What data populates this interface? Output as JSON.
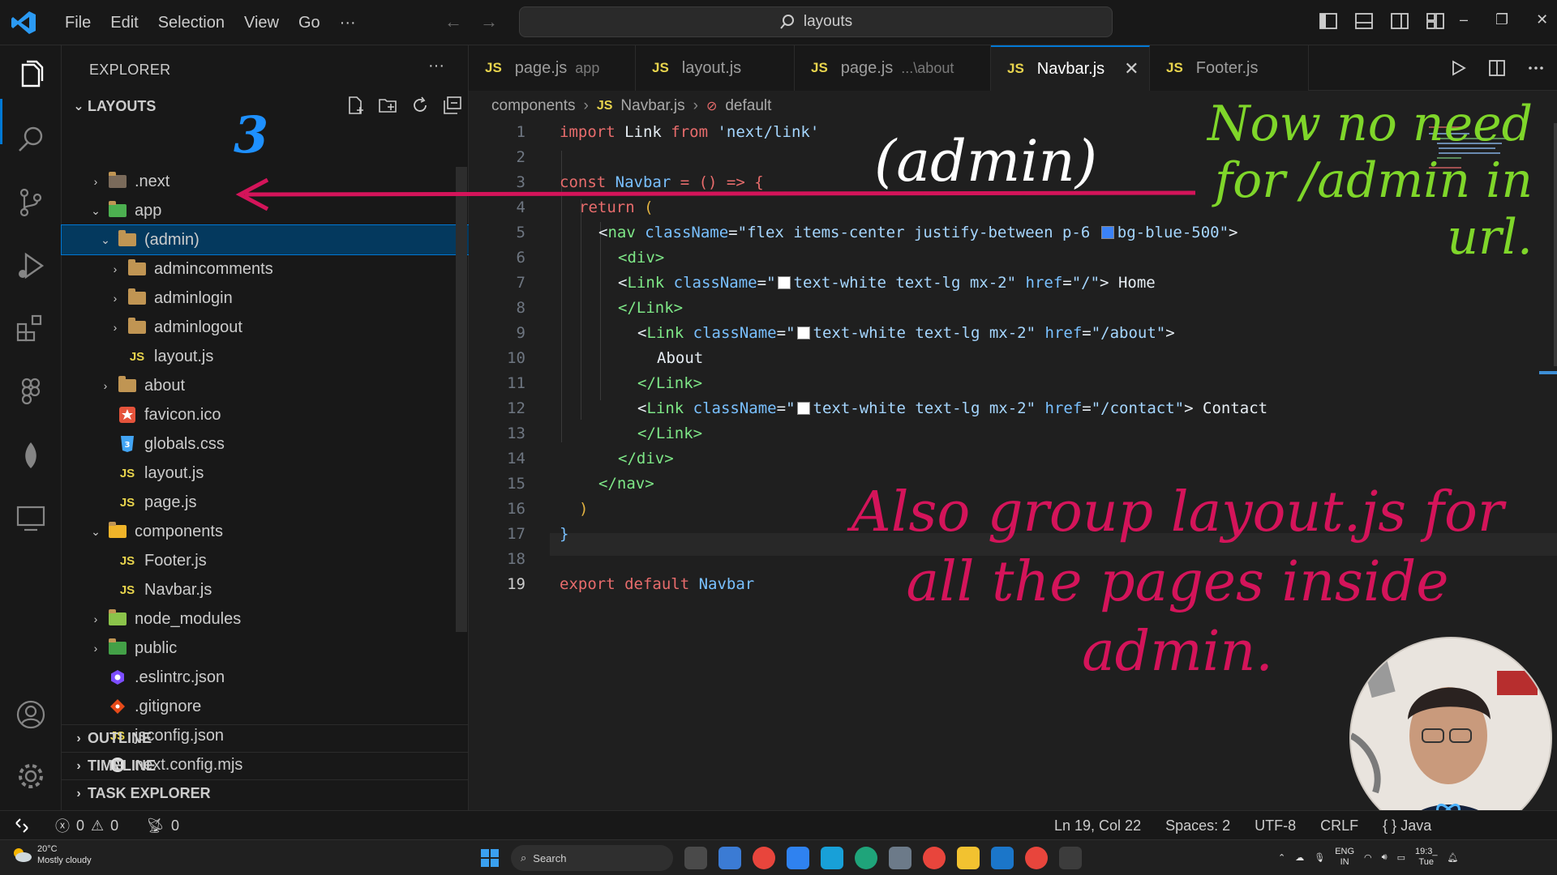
{
  "titlebar": {
    "menu": [
      "File",
      "Edit",
      "Selection",
      "View",
      "Go",
      "···"
    ],
    "search_text": "layouts"
  },
  "explorer": {
    "title": "EXPLORER",
    "more": "···",
    "root": "LAYOUTS",
    "items": [
      {
        "label": ".next",
        "icon": "next-folder-icon"
      },
      {
        "label": "app",
        "icon": "app-folder-icon"
      },
      {
        "label": "(admin)",
        "icon": "folder-icon"
      },
      {
        "label": "admincomments",
        "icon": "folder-icon"
      },
      {
        "label": "adminlogin",
        "icon": "folder-icon"
      },
      {
        "label": "adminlogout",
        "icon": "folder-icon"
      },
      {
        "label": "layout.js",
        "icon": "js-file-icon"
      },
      {
        "label": "about",
        "icon": "folder-icon"
      },
      {
        "label": "favicon.ico",
        "icon": "favicon-icon"
      },
      {
        "label": "globals.css",
        "icon": "css-file-icon"
      },
      {
        "label": "layout.js",
        "icon": "js-file-icon"
      },
      {
        "label": "page.js",
        "icon": "js-file-icon"
      },
      {
        "label": "components",
        "icon": "components-folder-icon"
      },
      {
        "label": "Footer.js",
        "icon": "js-file-icon"
      },
      {
        "label": "Navbar.js",
        "icon": "js-file-icon"
      },
      {
        "label": "node_modules",
        "icon": "node-modules-folder-icon"
      },
      {
        "label": "public",
        "icon": "public-folder-icon"
      },
      {
        "label": ".eslintrc.json",
        "icon": "eslint-file-icon"
      },
      {
        "label": ".gitignore",
        "icon": "git-file-icon"
      },
      {
        "label": "jsconfig.json",
        "icon": "js-config-icon"
      },
      {
        "label": "next.config.mjs",
        "icon": "next-config-icon"
      }
    ],
    "sections": [
      "OUTLINE",
      "TIMELINE",
      "TASK EXPLORER"
    ],
    "js_badge": "JS"
  },
  "tabs": [
    {
      "label": "page.js",
      "desc": "app"
    },
    {
      "label": "layout.js",
      "desc": ""
    },
    {
      "label": "page.js",
      "desc": "...\\about"
    },
    {
      "label": "Navbar.js",
      "desc": ""
    },
    {
      "label": "Footer.js",
      "desc": ""
    }
  ],
  "breadcrumb": {
    "folder": "components",
    "file": "Navbar.js",
    "symbol": "default"
  },
  "code": {
    "line_numbers": [
      "1",
      "2",
      "3",
      "4",
      "5",
      "6",
      "7",
      "8",
      "9",
      "10",
      "11",
      "12",
      "13",
      "14",
      "15",
      "16",
      "17",
      "18",
      "19"
    ],
    "current_line": "19",
    "l1": {
      "kw": "import",
      "name": " Link ",
      "from": "from",
      "str": " 'next/link'"
    },
    "l3": {
      "kw": "const",
      "name": " Navbar",
      "rest": " = () => {"
    },
    "l4": {
      "kw": "return",
      "rest": " ("
    },
    "l5": {
      "open": "<",
      "tag": "nav",
      "attr": " className",
      "eq": "=",
      "str1": "\"flex items-center justify-between p-6 ",
      "str2": "bg-blue-500\"",
      "close": ">"
    },
    "l6": {
      "text": "<div>"
    },
    "l7": {
      "open": "<",
      "tag": "Link",
      "attr": " className",
      "eq": "=",
      "q": "\"",
      "str": "text-white text-lg mx-2\"",
      "attr2": " href",
      "eq2": "=",
      "str2": "\"/\"",
      "close": ">",
      "text": " Home"
    },
    "l8": {
      "text": "</Link>"
    },
    "l9": {
      "open": "<",
      "tag": "Link",
      "attr": " className",
      "eq": "=",
      "q": "\"",
      "str": "text-white text-lg mx-2\"",
      "attr2": " href",
      "eq2": "=",
      "str2": "\"/about\"",
      "close": ">"
    },
    "l10": {
      "text": "About"
    },
    "l11": {
      "text": "</Link>"
    },
    "l12": {
      "open": "<",
      "tag": "Link",
      "attr": " className",
      "eq": "=",
      "q": "\"",
      "str": "text-white text-lg mx-2\"",
      "attr2": " href",
      "eq2": "=",
      "str2": "\"/contact\"",
      "close": ">",
      "text": " Contact"
    },
    "l13": {
      "text": "</Link>"
    },
    "l14": {
      "text": "</div>"
    },
    "l15": {
      "text": "</nav>"
    },
    "l16": {
      "text": ")"
    },
    "l17": {
      "text": "}"
    },
    "l19": {
      "kw1": "export",
      "kw2": " default",
      "name": " Navbar"
    }
  },
  "statusbar": {
    "errors": "0",
    "warnings": "0",
    "ports": "0",
    "position": "Ln 19, Col 22",
    "spaces": "Spaces: 2",
    "encoding": "UTF-8",
    "eol": "CRLF",
    "language": "Java"
  },
  "taskbar": {
    "temperature": "20°C",
    "weather": "Mostly cloudy",
    "search": "Search",
    "lang1": "ENG",
    "lang2": "IN",
    "time": "19:3_",
    "day": "Tue"
  },
  "annotations": {
    "green": "Now no need for /admin in url.",
    "pink": "Also group layout.js for all the pages inside admin.",
    "white": "(admin)",
    "blue": "3"
  },
  "colors": {
    "accent": "#0078d4",
    "annotation_green": "#7fd62a",
    "annotation_pink": "#d4145a",
    "js_yellow": "#e8d44d"
  }
}
